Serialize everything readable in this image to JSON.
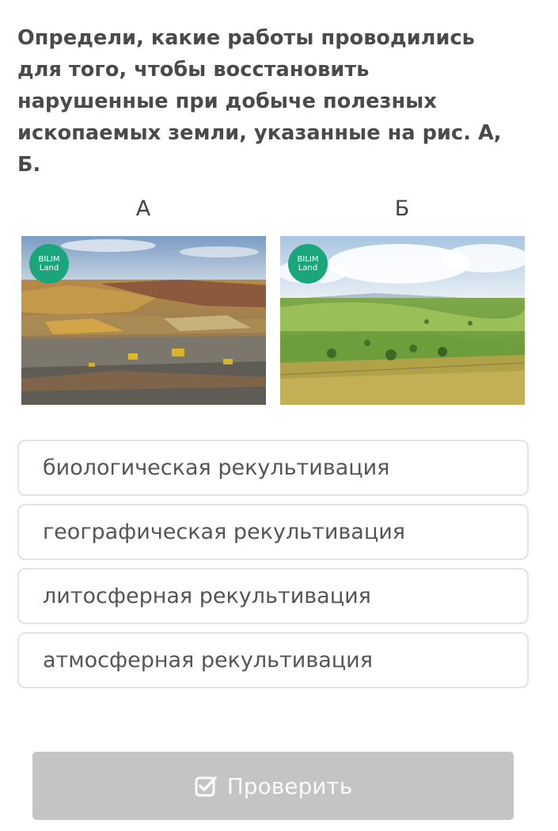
{
  "question": {
    "text": "Определи, какие работы проводились для того, чтобы восстановить нарушенные при добыче полезных ископаемых земли, указанные на рис. А, Б."
  },
  "images": [
    {
      "label": "А",
      "badge_line1": "BILIM",
      "badge_line2": "Land"
    },
    {
      "label": "Б",
      "badge_line1": "BILIM",
      "badge_line2": "Land"
    }
  ],
  "options": [
    "биологическая рекультивация",
    "географическая рекультивация",
    "литосферная рекультивация",
    "атмосферная рекультивация"
  ],
  "check_button": {
    "label": "Проверить",
    "icon": "checkbox-check-icon"
  },
  "colors": {
    "badge": "#1aa57a",
    "button_disabled": "#c4c4c4",
    "option_border": "#e3e3e3"
  }
}
